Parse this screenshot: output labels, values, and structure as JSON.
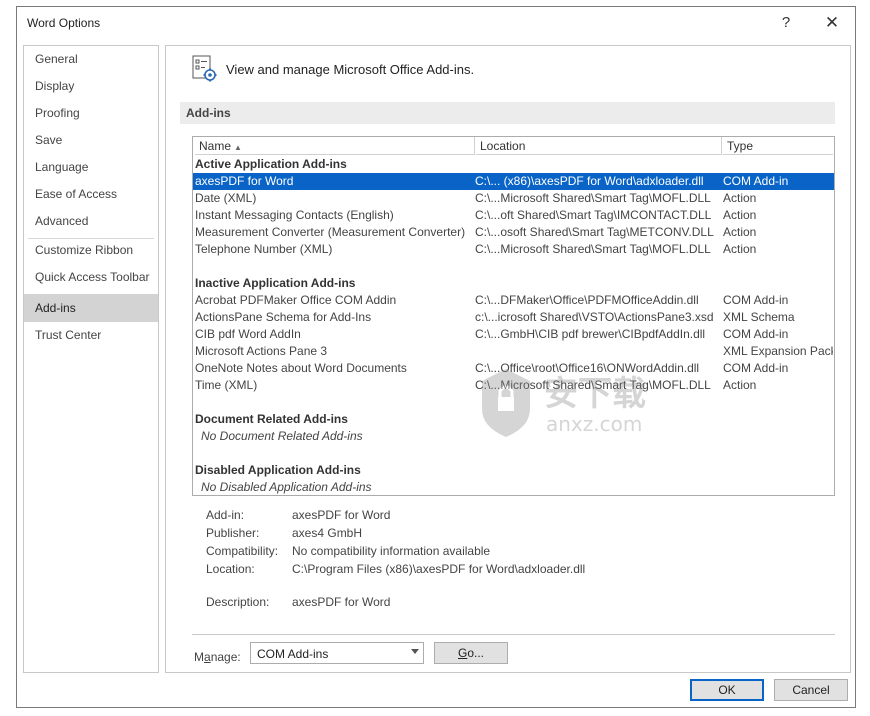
{
  "window": {
    "title": "Word Options",
    "help": "?",
    "close": "✕"
  },
  "nav": {
    "items": [
      "General",
      "Display",
      "Proofing",
      "Save",
      "Language",
      "Ease of Access",
      "Advanced",
      "Customize Ribbon",
      "Quick Access Toolbar",
      "Add-ins",
      "Trust Center"
    ],
    "selected": "Add-ins"
  },
  "header": {
    "text": "View and manage Microsoft Office Add-ins.",
    "section": "Add-ins"
  },
  "table": {
    "columns": {
      "name": "Name",
      "location": "Location",
      "type": "Type"
    },
    "groups": [
      {
        "title": "Active Application Add-ins",
        "rows": [
          {
            "name": "axesPDF for Word",
            "location": "C:\\... (x86)\\axesPDF for Word\\adxloader.dll",
            "type": "COM Add-in",
            "selected": true
          },
          {
            "name": "Date (XML)",
            "location": "C:\\...Microsoft Shared\\Smart Tag\\MOFL.DLL",
            "type": "Action"
          },
          {
            "name": "Instant Messaging Contacts (English)",
            "location": "C:\\...oft Shared\\Smart Tag\\IMCONTACT.DLL",
            "type": "Action"
          },
          {
            "name": "Measurement Converter (Measurement Converter)",
            "location": "C:\\...osoft Shared\\Smart Tag\\METCONV.DLL",
            "type": "Action"
          },
          {
            "name": "Telephone Number (XML)",
            "location": "C:\\...Microsoft Shared\\Smart Tag\\MOFL.DLL",
            "type": "Action"
          }
        ]
      },
      {
        "title": "Inactive Application Add-ins",
        "rows": [
          {
            "name": "Acrobat PDFMaker Office COM Addin",
            "location": "C:\\...DFMaker\\Office\\PDFMOfficeAddin.dll",
            "type": "COM Add-in"
          },
          {
            "name": "ActionsPane Schema for Add-Ins",
            "location": "c:\\...icrosoft Shared\\VSTO\\ActionsPane3.xsd",
            "type": "XML Schema"
          },
          {
            "name": "CIB pdf Word AddIn",
            "location": "C:\\...GmbH\\CIB pdf brewer\\CIBpdfAddIn.dll",
            "type": "COM Add-in"
          },
          {
            "name": "Microsoft Actions Pane 3",
            "location": "",
            "type": "XML Expansion Pack"
          },
          {
            "name": "OneNote Notes about Word Documents",
            "location": "C:\\...Office\\root\\Office16\\ONWordAddin.dll",
            "type": "COM Add-in"
          },
          {
            "name": "Time (XML)",
            "location": "C:\\...Microsoft Shared\\Smart Tag\\MOFL.DLL",
            "type": "Action"
          }
        ]
      },
      {
        "title": "Document Related Add-ins",
        "empty": "No Document Related Add-ins"
      },
      {
        "title": "Disabled Application Add-ins",
        "empty": "No Disabled Application Add-ins"
      }
    ]
  },
  "details": {
    "addin_label": "Add-in:",
    "addin": "axesPDF for Word",
    "publisher_label": "Publisher:",
    "publisher": "axes4 GmbH",
    "compat_label": "Compatibility:",
    "compat": "No compatibility information available",
    "location_label": "Location:",
    "location": "C:\\Program Files (x86)\\axesPDF for Word\\adxloader.dll",
    "desc_label": "Description:",
    "desc": "axesPDF for Word"
  },
  "manage": {
    "label_pre": "M",
    "label_u": "a",
    "label_post": "nage:",
    "value": "COM Add-ins",
    "go_u": "G",
    "go_post": "o..."
  },
  "buttons": {
    "ok": "OK",
    "cancel": "Cancel"
  },
  "watermark": {
    "cn": "安下载",
    "en": "anxz.com"
  }
}
